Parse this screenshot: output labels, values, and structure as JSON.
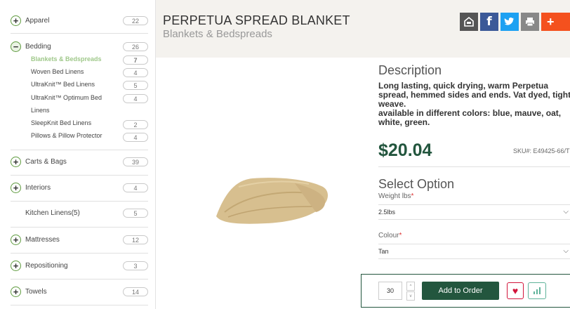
{
  "sidebar": {
    "categories": [
      {
        "label": "Apparel",
        "count": "22",
        "toggle": "+"
      },
      {
        "label": "Bedding",
        "count": "26",
        "toggle": "−"
      },
      {
        "label": "Carts & Bags",
        "count": "39",
        "toggle": "+"
      },
      {
        "label": "Interiors",
        "count": "4",
        "toggle": "+"
      },
      {
        "label": "Kitchen Linens(5)",
        "count": "5"
      },
      {
        "label": "Mattresses",
        "count": "12",
        "toggle": "+"
      },
      {
        "label": "Repositioning",
        "count": "3",
        "toggle": "+"
      },
      {
        "label": "Towels",
        "count": "14",
        "toggle": "+"
      }
    ],
    "bedding_sub": [
      {
        "label": "Blankets & Bedspreads",
        "count": "7"
      },
      {
        "label": "Woven Bed Linens",
        "count": "4"
      },
      {
        "label": "UltraKnit™ Bed Linens",
        "count": "5"
      },
      {
        "label": "UltraKnit™ Optimum Bed",
        "count": "4"
      },
      {
        "label": "Linens"
      },
      {
        "label": "SleepKnit Bed Linens",
        "count": "2"
      },
      {
        "label": "Pillows & Pillow Protector",
        "count": "4"
      }
    ]
  },
  "product": {
    "title": "PERPETUA SPREAD BLANKET",
    "category": "Blankets & Bedspreads",
    "description_heading": "Description",
    "description": "Long lasting, quick drying, warm Perpetua spread, hemmed sides and ends. Vat dyed, tight weave.",
    "description_colors": "available in different colors: blue, mauve, oat, white, green.",
    "price": "$20.04",
    "sku": "SKU#: E49425-66/T"
  },
  "options": {
    "heading": "Select Option",
    "weight_label": "Weight lbs",
    "weight_value": "2.5lbs",
    "colour_label": "Colour",
    "colour_value": "Tan",
    "required_mark": "*",
    "chevron": "⌵"
  },
  "order": {
    "quantity": "30",
    "spin_up": "^",
    "spin_down": "v",
    "add_label": "Add to Order",
    "heart": "♥"
  },
  "share": {
    "icons": [
      "print-ticket-icon",
      "facebook-icon",
      "twitter-icon",
      "print-icon",
      "more-share-icon"
    ],
    "glyphs": [
      "⎙",
      "f",
      "t",
      "⎙",
      "+"
    ],
    "colors": [
      "#555555",
      "#3b5998",
      "#1da1f2",
      "#888888",
      "#f4511e"
    ]
  },
  "colors": {
    "brand_green": "#23563e",
    "accent_green": "#5f9b3f",
    "active_sub": "#9fc88a",
    "header_bg": "#f4f2ee"
  }
}
